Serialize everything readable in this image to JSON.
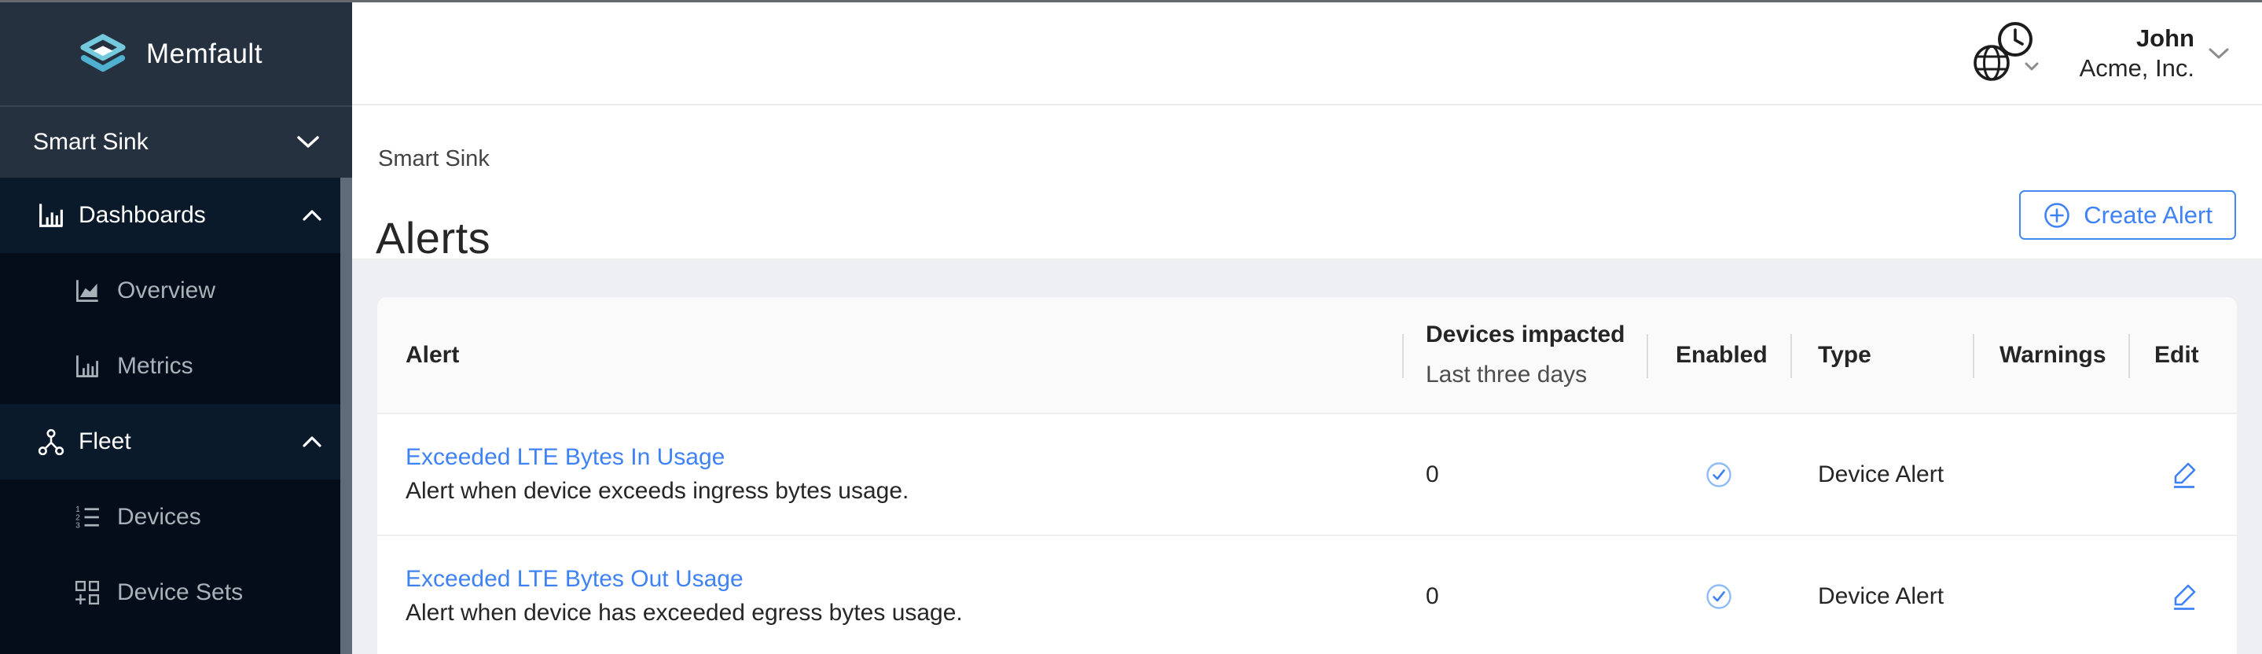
{
  "colors": {
    "accent_blue": "#3F82F6",
    "sidebar_top_bg": "#263140",
    "sidebar_group_bg": "#0B1A2B",
    "sidebar_submenu_bg": "#040D19",
    "page_gray_bg": "#EDEFF2",
    "enabled_check_blue": "#3F82F6",
    "logo_teal_light": "#74C9DC",
    "logo_teal_dark": "#4FB0CF"
  },
  "topbar": {
    "user_name": "John",
    "org_name": "Acme, Inc."
  },
  "sidebar": {
    "brand": "Memfault",
    "project_selector": "Smart Sink",
    "groups": [
      {
        "label": "Dashboards",
        "icon": "bar-chart-icon",
        "expanded": true,
        "items": [
          {
            "label": "Overview",
            "icon": "area-chart-icon"
          },
          {
            "label": "Metrics",
            "icon": "bar-chart-icon"
          }
        ]
      },
      {
        "label": "Fleet",
        "icon": "cluster-icon",
        "expanded": true,
        "items": [
          {
            "label": "Devices",
            "icon": "ordered-list-icon"
          },
          {
            "label": "Device Sets",
            "icon": "appstore-add-icon"
          }
        ]
      }
    ]
  },
  "main": {
    "breadcrumb": "Smart Sink",
    "page_title": "Alerts",
    "create_alert_label": "Create Alert",
    "table": {
      "col_alert": "Alert",
      "col_devices_line1": "Devices impacted",
      "col_devices_line2": "Last three days",
      "col_enabled": "Enabled",
      "col_type": "Type",
      "col_warnings": "Warnings",
      "col_edit": "Edit",
      "rows": [
        {
          "name": "Exceeded LTE Bytes In Usage",
          "description": "Alert when device exceeds ingress bytes usage.",
          "devices_impacted": "0",
          "enabled": true,
          "type": "Device Alert",
          "warnings": ""
        },
        {
          "name": "Exceeded LTE Bytes Out Usage",
          "description": "Alert when device has exceeded egress bytes usage.",
          "devices_impacted": "0",
          "enabled": true,
          "type": "Device Alert",
          "warnings": ""
        }
      ]
    }
  }
}
